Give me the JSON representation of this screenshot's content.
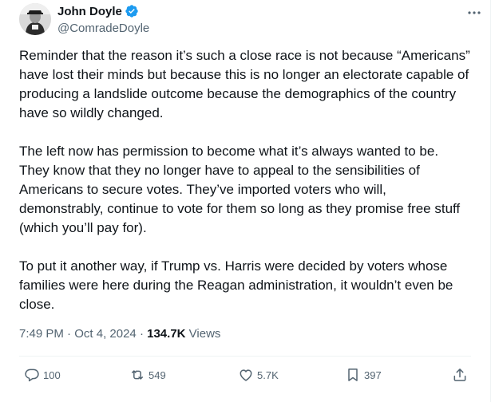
{
  "author": {
    "display_name": "John Doyle",
    "handle": "@ComradeDoyle",
    "verified": true
  },
  "tweet": {
    "paragraphs": [
      "Reminder that the reason it’s such a close race is not because “Americans” have lost their minds but because this is no longer an electorate capable of producing a landslide outcome because the demographics of the country have so wildly changed.",
      "The left now has permission to become what it’s always wanted to be. They know that they no longer have to appeal to the sensibilities of Americans to secure votes. They’ve imported voters who will, demonstrably, continue to vote for them so long as they promise free stuff (which you’ll pay for).",
      "To put it another way, if Trump vs. Harris were decided by voters whose families were here during the Reagan administration, it wouldn’t even be close."
    ],
    "time": "7:49 PM",
    "separator": "·",
    "date": "Oct 4, 2024",
    "views_count": "134.7K",
    "views_label": "Views"
  },
  "actions": {
    "replies": "100",
    "reposts": "549",
    "likes": "5.7K",
    "bookmarks": "397"
  },
  "icons": {
    "more": "more-icon",
    "reply": "reply-icon",
    "repost": "repost-icon",
    "like": "heart-icon",
    "bookmark": "bookmark-icon",
    "share": "share-icon",
    "verified": "verified-badge-icon"
  },
  "colors": {
    "text_primary": "#0f1419",
    "text_secondary": "#536471",
    "verified_blue": "#1d9bf0",
    "divider": "#eff3f4"
  }
}
